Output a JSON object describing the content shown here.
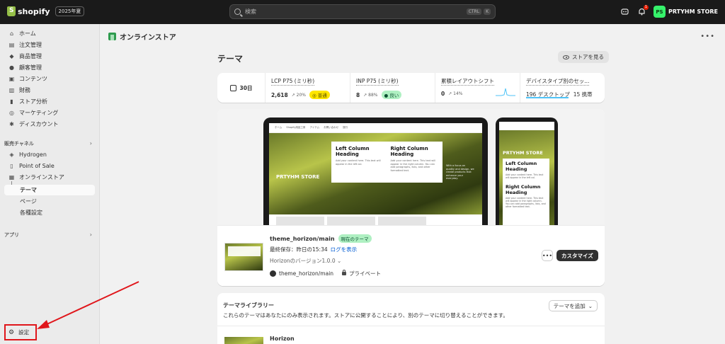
{
  "topbar": {
    "brand": "shopify",
    "edition": "2025年夏",
    "search_placeholder": "検索",
    "shortcut_keys": [
      "CTRL",
      "K"
    ],
    "notification_count": "1",
    "avatar_initials": "PS",
    "store_name": "PRTYHM STORE"
  },
  "sidebar": {
    "items": [
      {
        "label": "ホーム",
        "icon": "home-icon"
      },
      {
        "label": "注文管理",
        "icon": "inbox-icon"
      },
      {
        "label": "商品管理",
        "icon": "tag-icon"
      },
      {
        "label": "顧客管理",
        "icon": "person-icon"
      },
      {
        "label": "コンテンツ",
        "icon": "content-icon"
      },
      {
        "label": "財務",
        "icon": "bank-icon"
      },
      {
        "label": "ストア分析",
        "icon": "chart-icon"
      },
      {
        "label": "マーケティング",
        "icon": "target-icon"
      },
      {
        "label": "ディスカウント",
        "icon": "discount-icon"
      }
    ],
    "sales_channels_label": "販売チャネル",
    "channels": [
      {
        "label": "Hydrogen",
        "icon": "hydrogen-icon"
      },
      {
        "label": "Point of Sale",
        "icon": "pos-icon"
      },
      {
        "label": "オンラインストア",
        "icon": "store-icon"
      }
    ],
    "subitems": [
      "テーマ",
      "ページ",
      "各種設定"
    ],
    "apps_label": "アプリ",
    "settings_label": "設定"
  },
  "main": {
    "page_title": "オンラインストア",
    "section_title": "テーマ",
    "view_store": "ストアを見る",
    "metrics": {
      "period": "30日",
      "lcp": {
        "label": "LCP P75 (ミリ秒)",
        "value": "2,618",
        "delta": "↗ 20%",
        "status": "普通"
      },
      "inp": {
        "label": "INP P75 (ミリ秒)",
        "value": "8",
        "delta": "↗ 88%",
        "status": "良い"
      },
      "cls": {
        "label": "累積レイアウトシフト",
        "value": "0",
        "delta": "↗ 14%"
      },
      "device": {
        "label": "デバイスタイプ別のセッ...",
        "desktop": "196 デスクトップ",
        "mobile": "15 携帯"
      }
    },
    "preview": {
      "nav_items": [
        "ホーム",
        "Shopify用品工房",
        "アイテム",
        "お問い合わせ",
        "旅行"
      ],
      "brand": "PRTYHM STORE",
      "left_heading": "Left Column Heading",
      "left_text": "Add your content here. This text will appear in the left col.",
      "right_heading": "Right Column Heading",
      "right_text": "Add your content here. This text will appear in the right column. You can add paragraphs, lists, and other formatted text.",
      "side_text": "With a focus on quality and design, we create products that enhance your everyday.",
      "phone_left_text": "Add your content here. This text will appear in the left col.",
      "phone_right_text": "Add your content here. This text will appear in the right column. You can add paragraphs, lists, and other formatted text."
    },
    "current_theme": {
      "name": "theme_horizon/main",
      "badge": "現在のテーマ",
      "saved": "最終保存：昨日の15:34",
      "show_log": "ログを表示",
      "version": "Horizonのバージョン1.0.0",
      "repo": "theme_horizon/main",
      "privacy": "プライベート",
      "more": "•••",
      "customize": "カスタマイズ"
    },
    "library": {
      "title": "テーマライブラリー",
      "description": "これらのテーマはあなたにのみ表示されます。ストアに公開することにより、別のテーマに切り替えることができます。",
      "add_theme": "テーマを追加",
      "first_theme": "Horizon"
    }
  },
  "colors": {
    "annotation": "#e0161b",
    "accent_green": "#36f16b",
    "link": "#005bd3"
  }
}
